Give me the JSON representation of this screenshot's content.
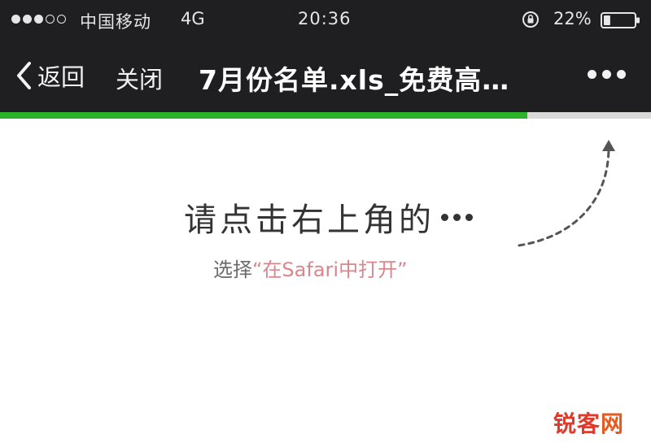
{
  "status_bar": {
    "signal_bars_filled": 3,
    "signal_bars_total": 5,
    "carrier": "中国移动",
    "network": "4G",
    "time": "20:36",
    "battery_percent": "22%",
    "battery_level": 0.22
  },
  "nav": {
    "back_label": "返回",
    "close_label": "关闭",
    "title": "7月份名单.xls_免费高…",
    "more_icon": "more-icon"
  },
  "page_load_progress": 0.81,
  "hint": {
    "main_text": "请点击右上角的",
    "sub_prefix": "选择",
    "sub_highlight": "“在Safari中打开”"
  },
  "watermark": {
    "part_a": "锐客",
    "part_b": "网"
  },
  "colors": {
    "bar_background": "#1f1f21",
    "progress": "#2bb32b",
    "highlight": "#d9868c",
    "watermark": "#e03a2a"
  }
}
